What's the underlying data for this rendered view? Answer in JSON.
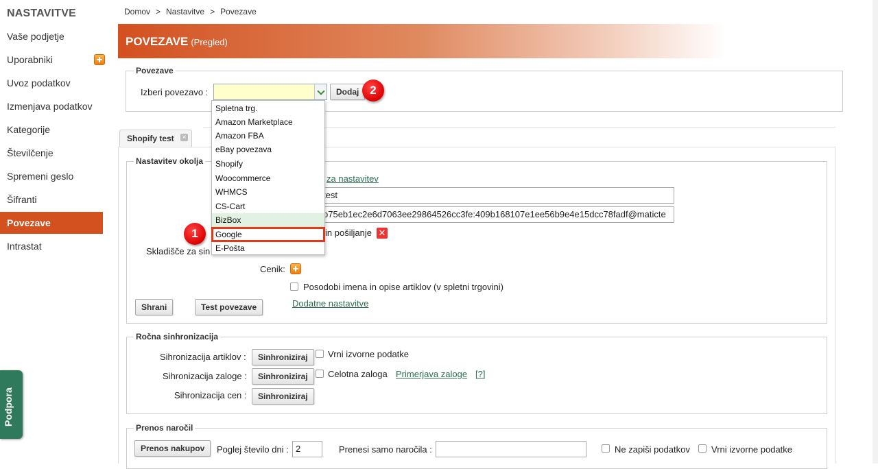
{
  "sidebar": {
    "title": "NASTAVITVE",
    "items": [
      {
        "label": "Vaše podjetje"
      },
      {
        "label": "Uporabniki"
      },
      {
        "label": "Uvoz podatkov"
      },
      {
        "label": "Izmenjava podatkov"
      },
      {
        "label": "Kategorije"
      },
      {
        "label": "Številčenje"
      },
      {
        "label": "Spremeni geslo"
      },
      {
        "label": "Šifranti"
      },
      {
        "label": "Povezave"
      },
      {
        "label": "Intrastat"
      }
    ],
    "support_label": "Podpora"
  },
  "breadcrumb": [
    "Domov",
    "Nastavitve",
    "Povezave"
  ],
  "header": {
    "title": "POVEZAVE",
    "subtitle": "(Pregled)"
  },
  "povezave": {
    "legend": "Povezave",
    "select_label": "Izberi povezavo :",
    "add_button": "Dodaj",
    "dropdown": [
      "Spletna trg.",
      "Amazon Marketplace",
      "Amazon FBA",
      "eBay povezava",
      "Shopify",
      "Woocommerce",
      "WHMCS",
      "CS-Cart",
      "BizBox",
      "Google",
      "E-Pošta"
    ],
    "selected": "Google"
  },
  "badges": {
    "one": "1",
    "two": "2"
  },
  "tab": {
    "label": "Shopify test",
    "close": "×"
  },
  "okolje": {
    "legend": "Nastavitev okolja",
    "link_partial": "za nastavitev",
    "name_value": "test",
    "key_value": "b75eb1ec2e6d7063ee29864526cc3fe:409b168107e1ee56b9e4e15dcc78fadf@maticte",
    "shipping_partial": "in pošiljanje",
    "warehouse_partial": "Skladišče za sin",
    "price_label": "Cenik:",
    "update_names_label": "Posodobi imena in opise artiklov (v spletni trgovini)",
    "save_button": "Shrani",
    "test_button": "Test povezave",
    "extra_link": "Dodatne nastavitve"
  },
  "rocna": {
    "legend": "Ročna sinhronizacija",
    "rows": [
      {
        "label": "Sihronizacija artiklov :",
        "button": "Sinhroniziraj"
      },
      {
        "label": "Sihronizacija zaloge :",
        "button": "Sinhroniziraj"
      },
      {
        "label": "Sihronizacija cen :",
        "button": "Sinhroniziraj"
      }
    ],
    "return_source": "Vrni izvorne podatke",
    "full_stock": "Celotna zaloga",
    "compare_link": "Primerjava zaloge",
    "help_link": "[?]"
  },
  "prenos": {
    "legend": "Prenos naročil",
    "button": "Prenos nakupov",
    "days_label": "Poglej število dni :",
    "days_value": "2",
    "only_orders_label": "Prenesi samo naročila :",
    "no_write_label": "Ne zapiši podatkov",
    "return_source": "Vrni izvorne podatke"
  }
}
